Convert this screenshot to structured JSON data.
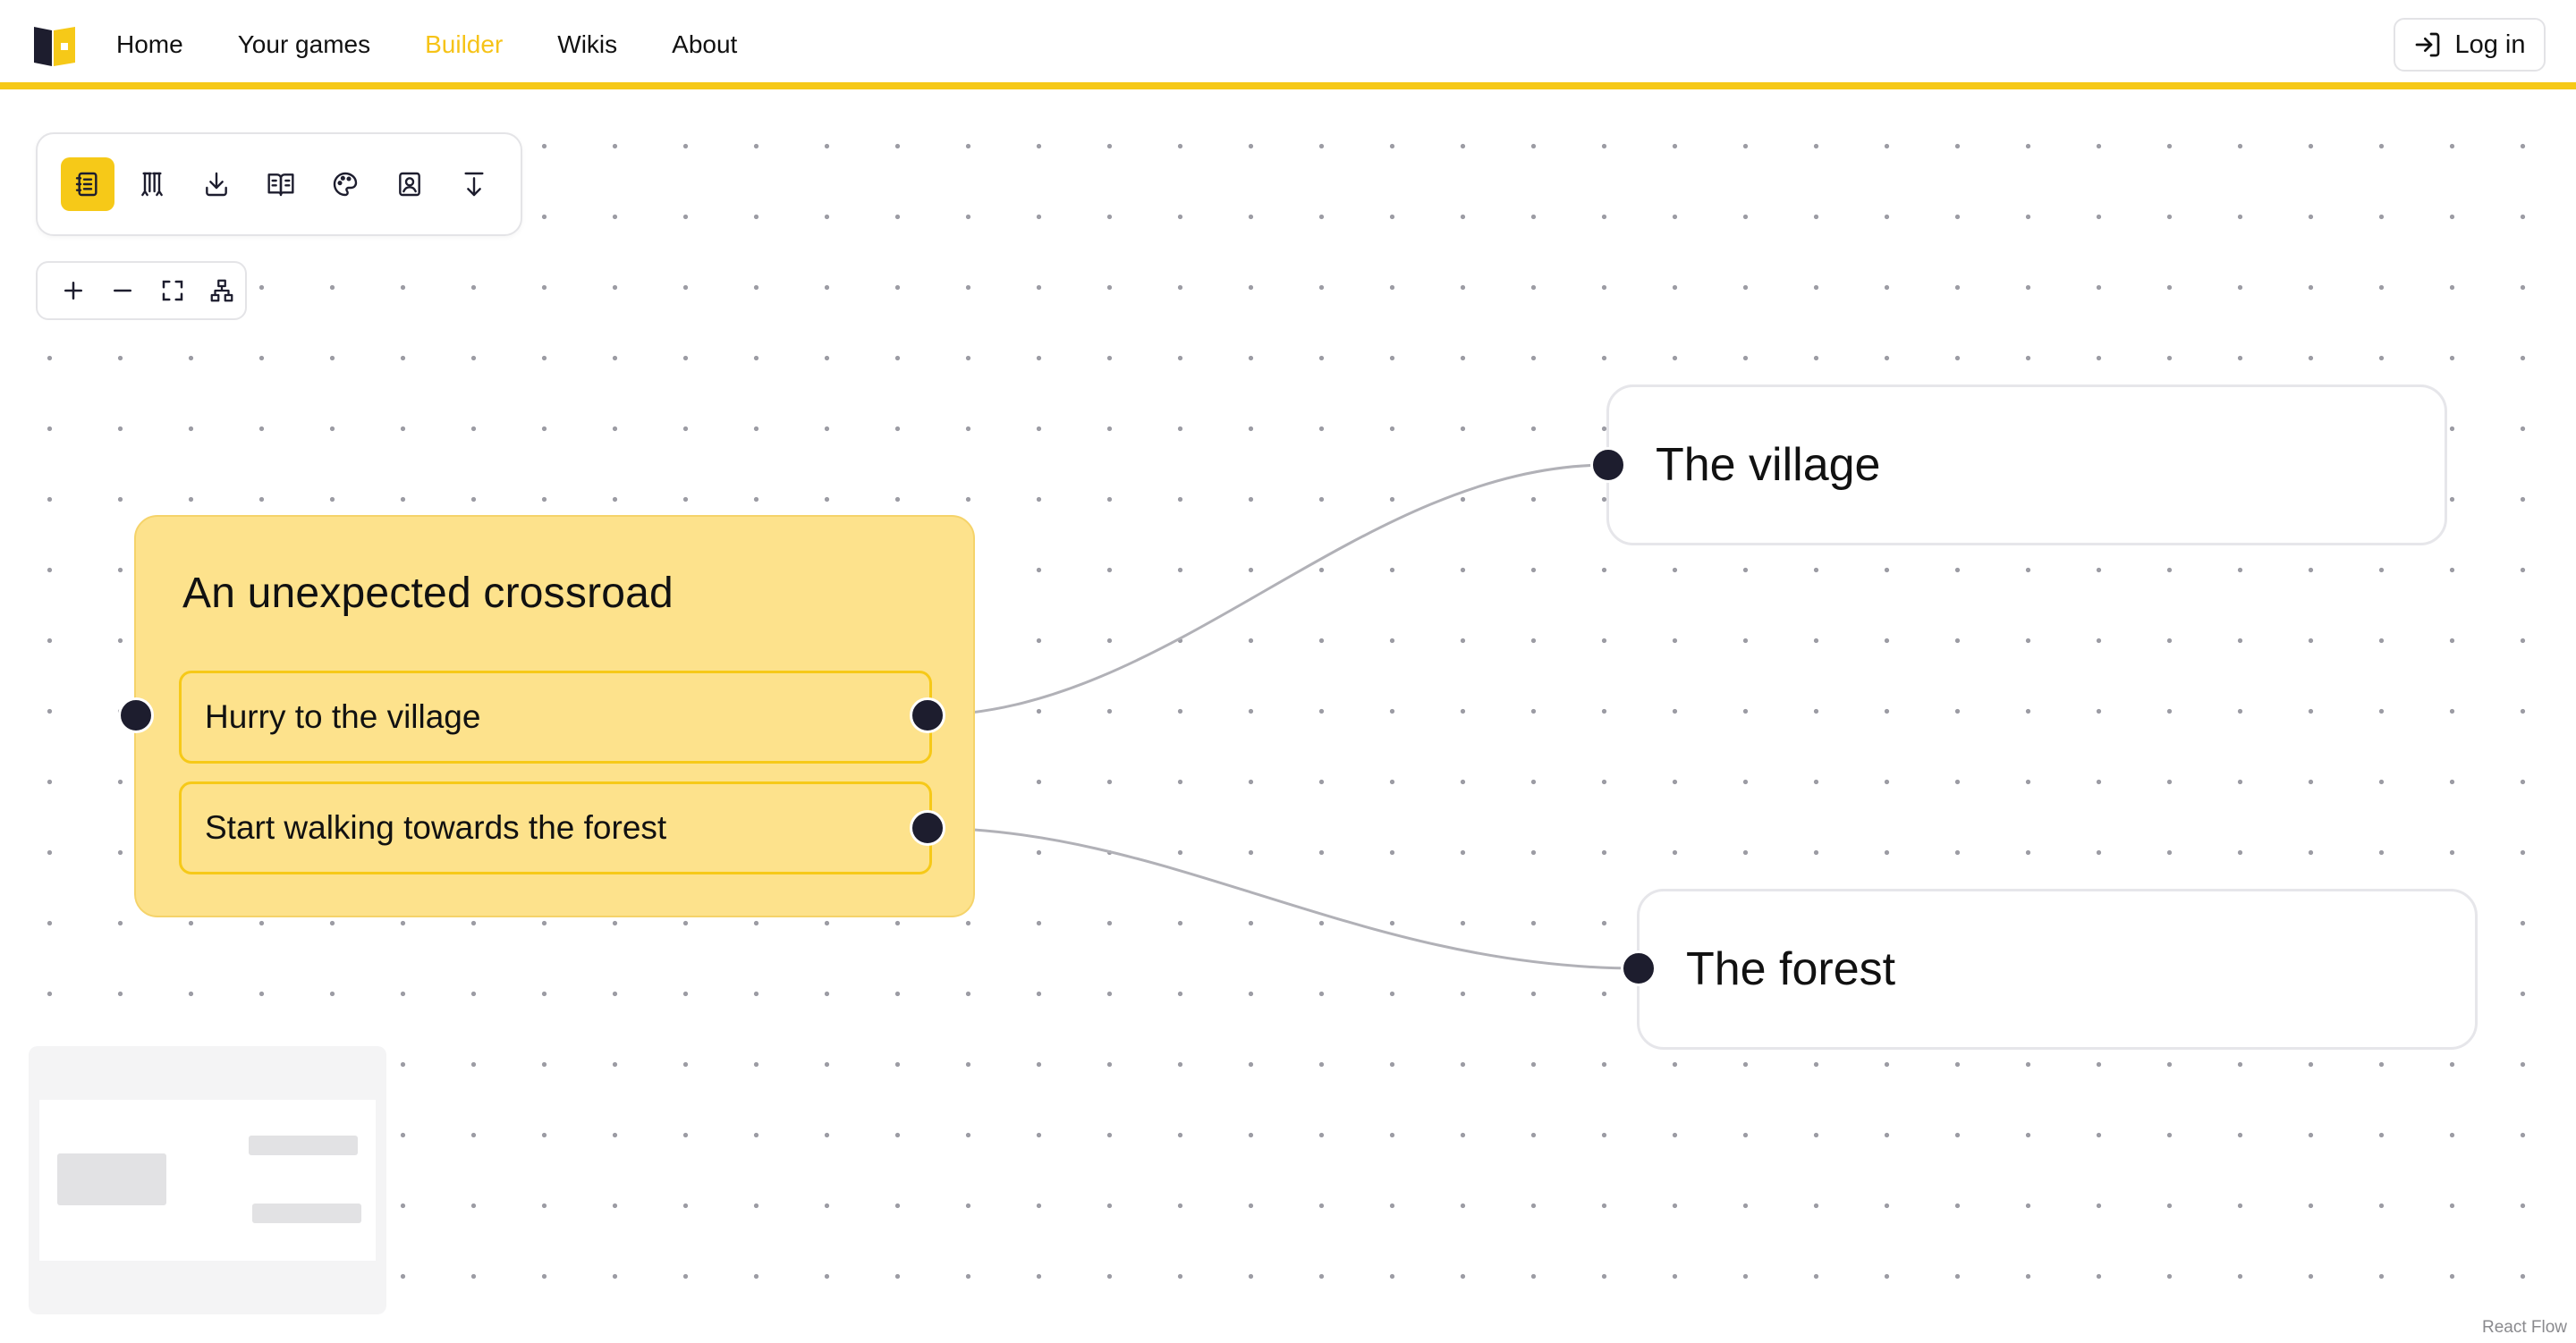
{
  "nav": {
    "links": [
      {
        "label": "Home"
      },
      {
        "label": "Your games"
      },
      {
        "label": "Builder"
      },
      {
        "label": "Wikis"
      },
      {
        "label": "About"
      }
    ],
    "active": "Builder",
    "login_label": "Log in",
    "accent_color": "#f6c918"
  },
  "toolbar": {
    "tools": [
      "scenes-icon",
      "columns-icon",
      "download-icon",
      "book-open-icon",
      "palette-icon",
      "contact-icon",
      "export-icon"
    ],
    "active_tool": "scenes-icon"
  },
  "zoom_controls": [
    "zoom-in-icon",
    "zoom-out-icon",
    "fit-view-icon",
    "layout-icon"
  ],
  "nodes": {
    "main": {
      "title": "An unexpected crossroad",
      "choices": [
        {
          "label": "Hurry to the village",
          "target": "village"
        },
        {
          "label": "Start walking towards the forest",
          "target": "forest"
        }
      ]
    },
    "village": {
      "title": "The village"
    },
    "forest": {
      "title": "The forest"
    }
  },
  "attribution": "React Flow"
}
